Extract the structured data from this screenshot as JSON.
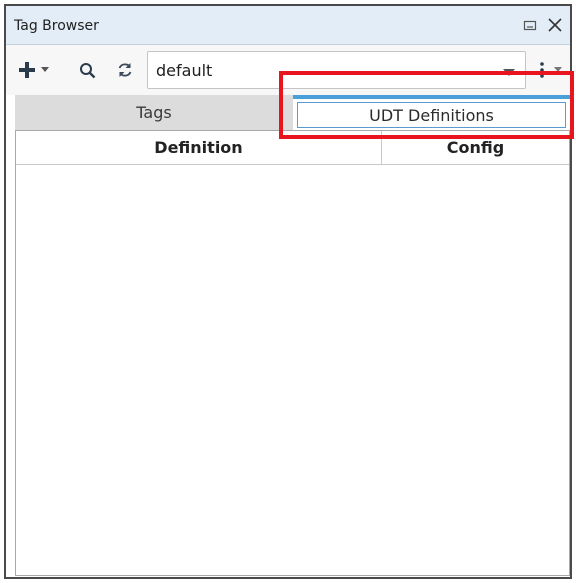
{
  "window": {
    "title": "Tag Browser"
  },
  "toolbar": {
    "provider_value": "default"
  },
  "tabs": [
    {
      "label": "Tags",
      "selected": false
    },
    {
      "label": "UDT Definitions",
      "selected": true
    }
  ],
  "table": {
    "columns": [
      "Definition",
      "Config"
    ],
    "rows": []
  },
  "colors": {
    "titlebar": "#e3edf7",
    "selected_tab_accent": "#4a9fd8",
    "highlight_box": "#e8141e"
  },
  "icons": [
    "restore-icon",
    "close-icon",
    "add-icon",
    "dropdown-arrow-icon",
    "search-icon",
    "refresh-icon",
    "menu-icon"
  ]
}
